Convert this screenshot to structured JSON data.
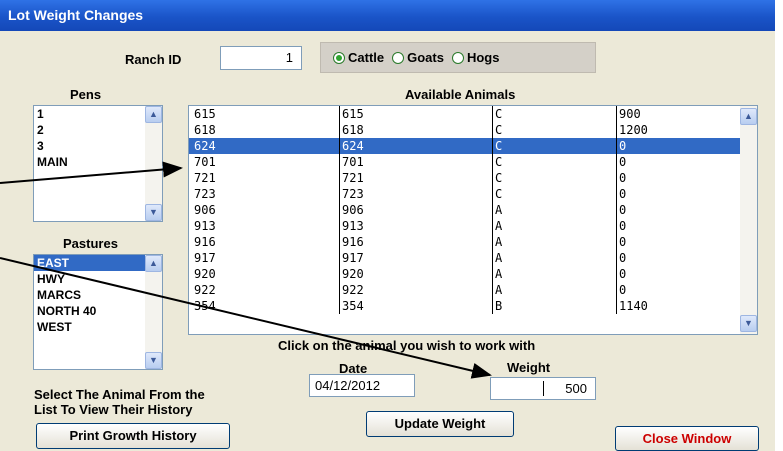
{
  "window": {
    "title": "Lot Weight Changes"
  },
  "ranch": {
    "label": "Ranch ID",
    "value": "1"
  },
  "species": [
    {
      "label": "Cattle",
      "selected": true
    },
    {
      "label": "Goats",
      "selected": false
    },
    {
      "label": "Hogs",
      "selected": false
    }
  ],
  "pens": {
    "header": "Pens",
    "items": [
      "1",
      "2",
      "3",
      "MAIN"
    ]
  },
  "pastures": {
    "header": "Pastures",
    "items": [
      "EAST",
      "HWY",
      "MARCS",
      "NORTH 40",
      "WEST"
    ],
    "selected_index": 0
  },
  "animals": {
    "header": "Available Animals",
    "selected_index": 2,
    "rows": [
      [
        "615",
        "615",
        "C",
        "900"
      ],
      [
        "618",
        "618",
        "C",
        "1200"
      ],
      [
        "624",
        "624",
        "C",
        "0"
      ],
      [
        "701",
        "701",
        "C",
        "0"
      ],
      [
        "721",
        "721",
        "C",
        "0"
      ],
      [
        "723",
        "723",
        "C",
        "0"
      ],
      [
        "906",
        "906",
        "A",
        "0"
      ],
      [
        "913",
        "913",
        "A",
        "0"
      ],
      [
        "916",
        "916",
        "A",
        "0"
      ],
      [
        "917",
        "917",
        "A",
        "0"
      ],
      [
        "920",
        "920",
        "A",
        "0"
      ],
      [
        "922",
        "922",
        "A",
        "0"
      ],
      [
        "354",
        "354",
        "B",
        "1140"
      ]
    ]
  },
  "instruction": "Click on the animal you wish to work with",
  "date": {
    "label": "Date",
    "value": "04/12/2012"
  },
  "weight": {
    "label": "Weight",
    "value": "500"
  },
  "select_hint": {
    "line1": "Select The Animal From the",
    "line2": "List To View Their History"
  },
  "buttons": {
    "print_growth": "Print Growth History",
    "update_weight": "Update Weight",
    "close_window": "Close Window"
  },
  "colors": {
    "title_bar": "#1a54c8",
    "selection": "#316ac5",
    "close_text": "#cc0000"
  }
}
